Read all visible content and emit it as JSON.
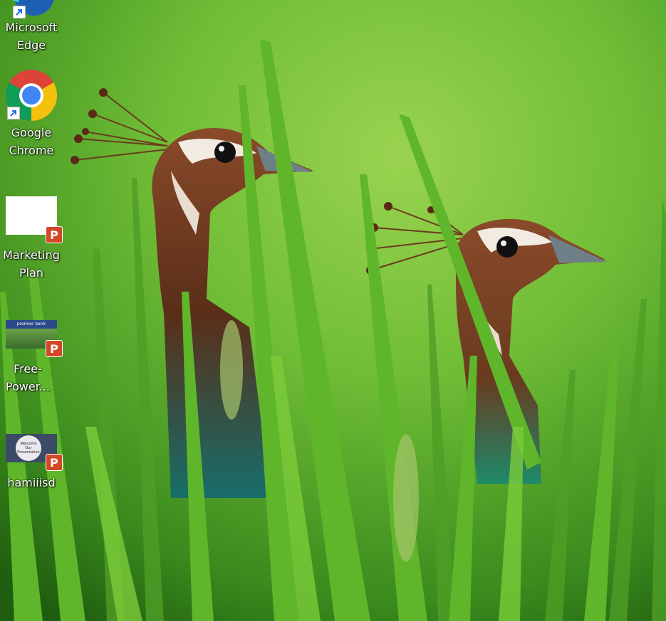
{
  "desktop": {
    "icons": [
      {
        "label": "Microsoft Edge",
        "icon": "edge-icon"
      },
      {
        "label": "Google Chrome",
        "icon": "chrome-icon"
      },
      {
        "label": "Marketing Plan",
        "icon": "powerpoint-file-icon"
      },
      {
        "label": "Free-Power...",
        "icon": "powerpoint-file-icon"
      },
      {
        "label": "hamiiisd",
        "icon": "powerpoint-file-icon"
      }
    ],
    "thumbnail_text": {
      "free_power": "premier bank",
      "hamiiisd_line1": "Welcome",
      "hamiiisd_line2": "Our",
      "hamiiisd_line3": "Presentation"
    },
    "powerpoint_badge": "P",
    "colors": {
      "powerpoint": "#d24726",
      "chrome_red": "#db4437",
      "chrome_yellow": "#f4c20d",
      "chrome_green": "#0f9d58",
      "chrome_blue": "#4285f4",
      "edge_blue": "#1e5fb4"
    }
  }
}
